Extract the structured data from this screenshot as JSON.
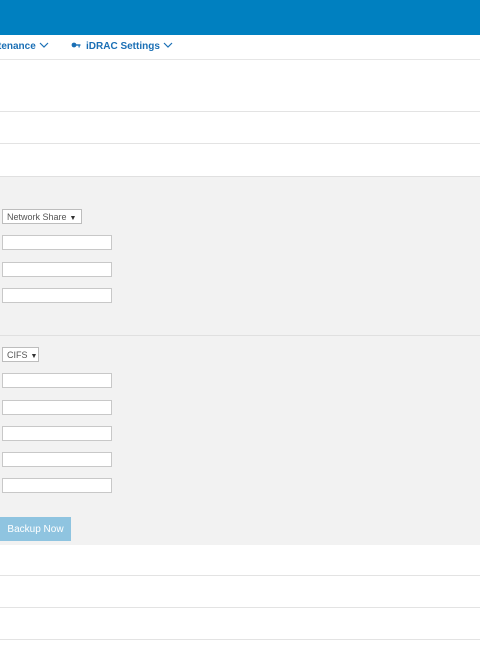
{
  "nav": {
    "items": [
      {
        "label": "tenance",
        "icon": "chevron-down-icon"
      },
      {
        "label": "iDRAC Settings",
        "icon": "key-icon",
        "chevron": "chevron-down-icon"
      }
    ]
  },
  "backup_form": {
    "location_select": {
      "value": "Network Share",
      "icon": "caret-down-icon"
    },
    "share_type_select": {
      "value": "CIFS",
      "icon": "caret-down-icon"
    },
    "backup_button": {
      "label": "Backup Now"
    }
  },
  "colors": {
    "header": "#0080c0",
    "nav_text": "#1a6fb5",
    "panel": "#f2f2f2",
    "button": "#8fc4e0"
  }
}
